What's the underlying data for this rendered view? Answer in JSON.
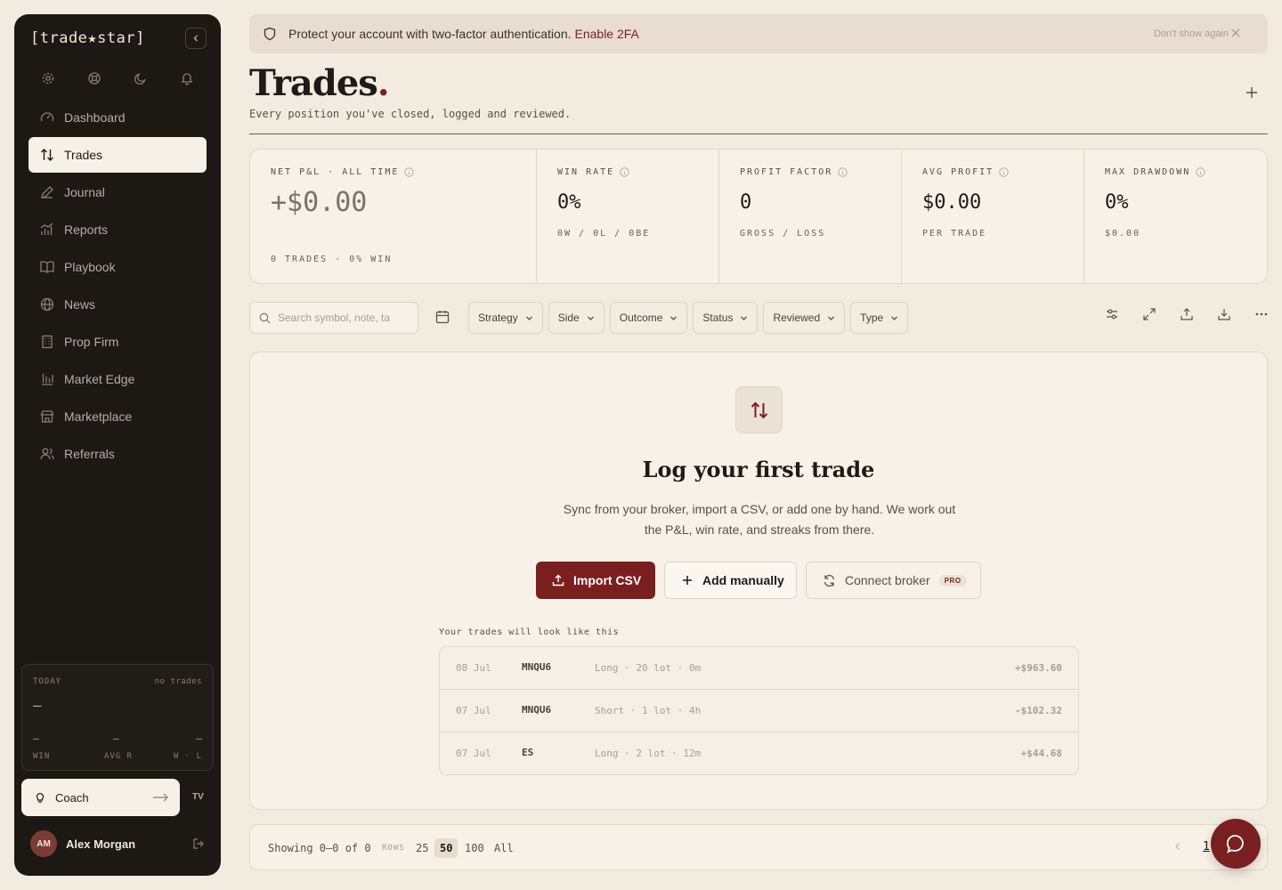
{
  "sidebar": {
    "logo": "[trade★star]",
    "nav": [
      {
        "label": "Dashboard",
        "icon": "gauge-icon"
      },
      {
        "label": "Trades",
        "icon": "arrows-up-down-icon",
        "active": true
      },
      {
        "label": "Journal",
        "icon": "pencil-icon"
      },
      {
        "label": "Reports",
        "icon": "chart-icon"
      },
      {
        "label": "Playbook",
        "icon": "book-open-icon"
      },
      {
        "label": "News",
        "icon": "globe-icon"
      },
      {
        "label": "Prop Firm",
        "icon": "building-icon"
      },
      {
        "label": "Market Edge",
        "icon": "bar-chart-icon"
      },
      {
        "label": "Marketplace",
        "icon": "store-icon"
      },
      {
        "label": "Referrals",
        "icon": "users-icon"
      }
    ],
    "today": {
      "label": "TODAY",
      "status": "no trades",
      "value": "—",
      "win_label": "WIN",
      "win_value": "—",
      "avg_label": "AVG R",
      "avg_value": "—",
      "wl_label": "W · L",
      "wl_value": "—"
    },
    "coach_label": "Coach",
    "tv_label": "TV",
    "user": {
      "initials": "AM",
      "name": "Alex Morgan"
    }
  },
  "banner": {
    "text": "Protect your account with two-factor authentication.",
    "link": "Enable 2FA",
    "dismiss": "Don't show again"
  },
  "page": {
    "title": "Trades",
    "title_dot": ".",
    "subtitle": "Every position you've closed, logged and reviewed."
  },
  "stats": [
    {
      "label": "NET P&L · ALL TIME",
      "value": "+$0.00",
      "sub": "0 TRADES · 0% WIN"
    },
    {
      "label": "WIN RATE",
      "value": "0%",
      "sub": "0W / 0L / 0BE"
    },
    {
      "label": "PROFIT FACTOR",
      "value": "0",
      "sub": "GROSS / LOSS"
    },
    {
      "label": "AVG PROFIT",
      "value": "$0.00",
      "sub": "PER TRADE"
    },
    {
      "label": "MAX DRAWDOWN",
      "value": "0%",
      "sub": "$0.00"
    }
  ],
  "toolbar": {
    "search_placeholder": "Search symbol, note, ta",
    "filters": [
      "Strategy",
      "Side",
      "Outcome",
      "Status",
      "Reviewed",
      "Type"
    ]
  },
  "empty": {
    "title": "Log your first trade",
    "description": "Sync from your broker, import a CSV, or add one by hand. We work out the P&L, win rate, and streaks from there.",
    "import_label": "Import CSV",
    "manual_label": "Add manually",
    "broker_label": "Connect broker",
    "pro_badge": "PRO",
    "preview_label": "Your trades will look like this",
    "preview_rows": [
      {
        "date": "08 Jul",
        "symbol": "MNQU6",
        "detail": "Long · 20 lot · 0m",
        "pnl": "+$963.60"
      },
      {
        "date": "07 Jul",
        "symbol": "MNQU6",
        "detail": "Short · 1 lot · 4h",
        "pnl": "-$102.32"
      },
      {
        "date": "07 Jul",
        "symbol": "ES",
        "detail": "Long · 2 lot · 12m",
        "pnl": "+$44.68"
      }
    ]
  },
  "footer": {
    "showing": "Showing 0–0 of 0",
    "rows_label": "ROWS",
    "row_options": [
      "25",
      "50",
      "100",
      "All"
    ],
    "active_rows": "50",
    "page": "1"
  }
}
